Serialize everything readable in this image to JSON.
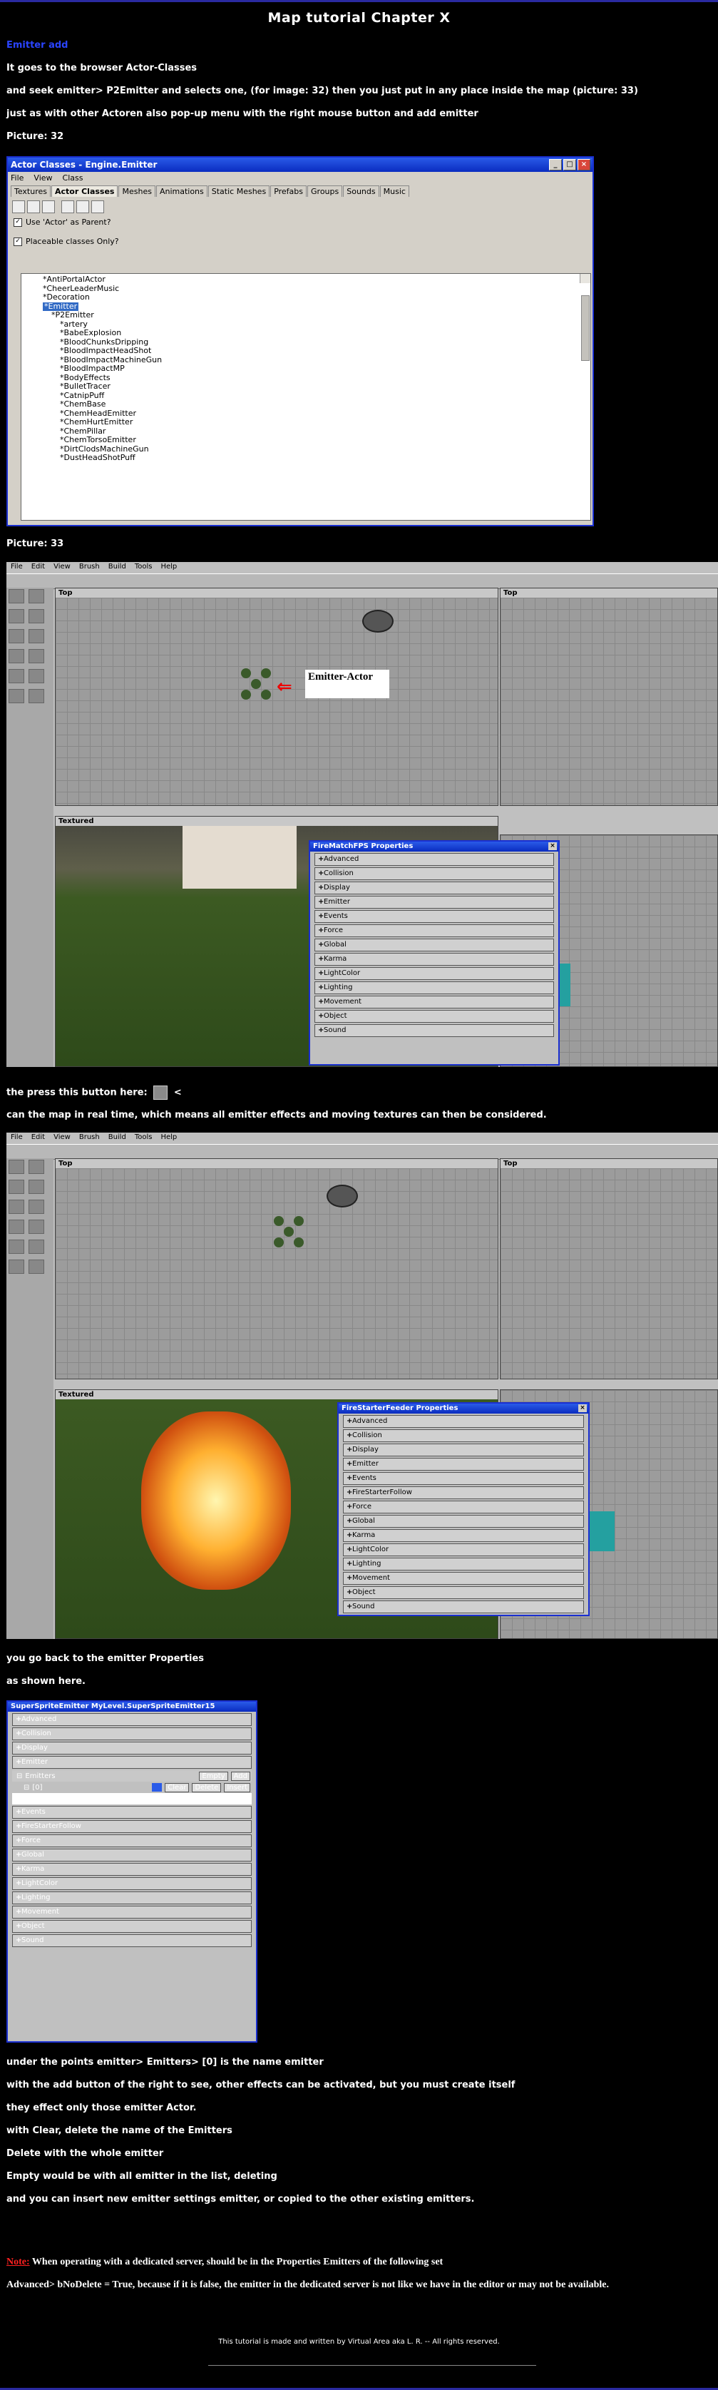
{
  "page": {
    "title": "Map tutorial Chapter X",
    "section_heading": "Emitter add",
    "intro_lines": [
      "It goes to the browser Actor-Classes",
      "and seek emitter> P2Emitter and selects one, (for image: 32) then you just put in any place inside the map (picture: 33)",
      "just as with other Actoren also pop-up menu with the right mouse button and add emitter"
    ],
    "picture32_label": "Picture: 32",
    "picture33_label": "Picture: 33",
    "press_button_text": "the press this button here:",
    "press_button_after": "<",
    "realtime_text": "can the map in real time, which means all emitter effects and moving textures can then be considered.",
    "back_lines": [
      "you go back to the emitter Properties",
      "as shown here."
    ],
    "explain_lines": [
      "under the points emitter> Emitters> [0] is the name emitter",
      "with the add button of the right to see, other effects can be activated, but you must create itself",
      "they effect only those emitter Actor.",
      "with Clear, delete the name of the Emitters",
      "Delete with the whole emitter",
      "Empty would be with all emitter in the list, deleting",
      "and you can insert new emitter settings emitter, or copied to the other existing emitters."
    ],
    "note_label": "Note:",
    "note_text": "When operating with a dedicated server, should be in the Properties Emitters of the following set",
    "note_line2": "Advanced> bNoDelete = True, because if it is false, the emitter in the dedicated server is not like we have in the editor or may not be available.",
    "footer": "This tutorial is made and written by Virtual Area aka L. R. -- All rights reserved.",
    "colors": {
      "accent_blue": "#2a44ff",
      "note_red": "#ff2020",
      "window_border": "#1a2fd0"
    }
  },
  "actor_window": {
    "title": "Actor Classes - Engine.Emitter",
    "menu": [
      "File",
      "View",
      "Class"
    ],
    "tabs": [
      "Textures",
      "Actor Classes",
      "Meshes",
      "Animations",
      "Static Meshes",
      "Prefabs",
      "Groups",
      "Sounds",
      "Music"
    ],
    "active_tab": "Actor Classes",
    "check1": "Use 'Actor' as Parent?",
    "check2": "Placeable classes Only?",
    "tree": [
      "*AntiPortalActor",
      "*CheerLeaderMusic",
      "*Decoration",
      "*Emitter",
      "*P2Emitter",
      "*artery",
      "*BabeExplosion",
      "*BloodChunksDripping",
      "*BloodImpactHeadShot",
      "*BloodImpactMachineGun",
      "*BloodImpactMP",
      "*BodyEffects",
      "*BulletTracer",
      "*CatnipPuff",
      "*ChemBase",
      "*ChemHeadEmitter",
      "*ChemHurtEmitter",
      "*ChemPillar",
      "*ChemTorsoEmitter",
      "*DirtClodsMachineGun",
      "*DustHeadShotPuff"
    ]
  },
  "editor1": {
    "menu": [
      "File",
      "Edit",
      "View",
      "Brush",
      "Build",
      "Tools",
      "Help"
    ],
    "vp_top_left": "Top",
    "vp_top_right": "Top",
    "vp_textured": "Textured",
    "emitter_label": "Emitter-Actor",
    "props_title": "FireMatchFPS Properties",
    "props": [
      "Advanced",
      "Collision",
      "Display",
      "Emitter",
      "Events",
      "Force",
      "Global",
      "Karma",
      "LightColor",
      "Lighting",
      "Movement",
      "Object",
      "Sound"
    ]
  },
  "editor2": {
    "menu": [
      "File",
      "Edit",
      "View",
      "Brush",
      "Build",
      "Tools",
      "Help"
    ],
    "vp_top_left": "Top",
    "vp_top_right": "Top",
    "vp_textured": "Textured",
    "props_title": "FireStarterFeeder Properties",
    "props": [
      "Advanced",
      "Collision",
      "Display",
      "Emitter",
      "Events",
      "FireStarterFollow",
      "Force",
      "Global",
      "Karma",
      "LightColor",
      "Lighting",
      "Movement",
      "Object",
      "Sound"
    ]
  },
  "emitter_props": {
    "title": "SuperSpriteEmitter MyLevel.SuperSpriteEmitter15",
    "rows_before": [
      "Advanced",
      "Collision",
      "Display",
      "Emitter"
    ],
    "emitters_label": "Emitters",
    "empty_btn": "Empty",
    "add_btn": "Add",
    "index_label": "[0]",
    "clear_btn": "Clear",
    "delete_btn": "Delete",
    "insert_btn": "Insert",
    "value": "SuperSpriteEmitter MyLevel.SuperSpriteEmitter15",
    "rows_after": [
      "Events",
      "FireStarterFollow",
      "Force",
      "Global",
      "Karma",
      "LightColor",
      "Lighting",
      "Movement",
      "Object",
      "Sound"
    ]
  }
}
